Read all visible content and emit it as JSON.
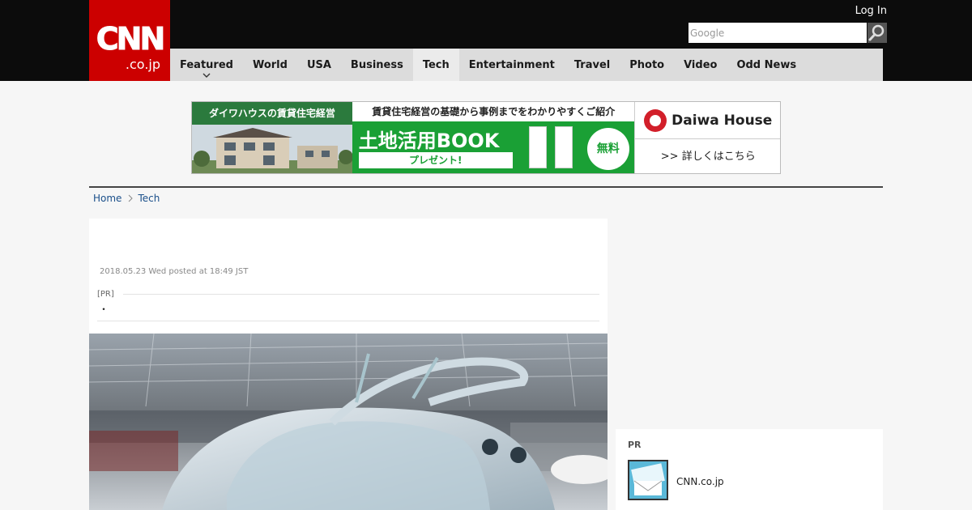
{
  "header": {
    "logo": {
      "mark": "CNN",
      "sub": ".co.jp"
    },
    "login_label": "Log In",
    "search": {
      "placeholder": "Google"
    },
    "nav": [
      {
        "label": "Featured",
        "has_dropdown": true,
        "active": false
      },
      {
        "label": "World",
        "active": false
      },
      {
        "label": "USA",
        "active": false
      },
      {
        "label": "Business",
        "active": false
      },
      {
        "label": "Tech",
        "active": true
      },
      {
        "label": "Entertainment",
        "active": false
      },
      {
        "label": "Travel",
        "active": false
      },
      {
        "label": "Photo",
        "active": false
      },
      {
        "label": "Video",
        "active": false
      },
      {
        "label": "Odd News",
        "active": false
      }
    ]
  },
  "ad": {
    "left_title": "ダイワハウスの賃貸住宅経営",
    "mid_top": "賃貸住宅経営の基礎から事例までをわかりやすくご紹介",
    "mid_big": "土地活用BOOK",
    "mid_button": "プレゼント!",
    "free_badge": "無料",
    "brand": "Daiwa House",
    "more_link": ">> 詳しくはこちら"
  },
  "breadcrumb": [
    {
      "label": "Home"
    },
    {
      "label": "Tech"
    }
  ],
  "article": {
    "date": "2018.05.23 Wed posted at 18:49 JST",
    "pr_label": "[PR]",
    "pr_text": "・"
  },
  "sidebar": {
    "pr_title": "PR",
    "pr_item_label": "CNN.co.jp"
  },
  "colors": {
    "header_bg": "#0c0c0c",
    "logo_red": "#cc0000",
    "nav_bg": "#dcdcdc",
    "nav_active": "#ebebeb",
    "link": "#1a4f8a",
    "ad_green": "#1aa035"
  }
}
